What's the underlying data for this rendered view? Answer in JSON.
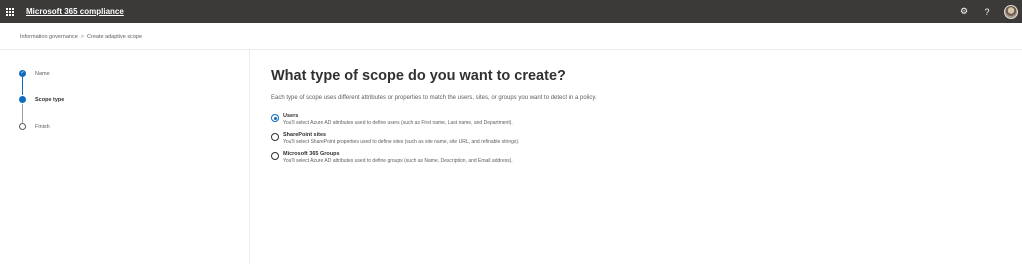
{
  "app": {
    "title": "Microsoft 365 compliance"
  },
  "topbar": {
    "icons": [
      "waffle-icon",
      "gear-icon",
      "help-icon",
      "avatar"
    ],
    "help_label": "?"
  },
  "breadcrumb": {
    "items": [
      "Information governance",
      "Create adaptive scope"
    ],
    "separator": ">"
  },
  "steps": [
    {
      "label": "Name",
      "state": "done"
    },
    {
      "label": "Scope type",
      "state": "current"
    },
    {
      "label": "Finish",
      "state": "todo"
    }
  ],
  "main": {
    "heading": "What type of scope do you want to create?",
    "description": "Each type of scope uses different attributes or properties to match the users, sites, or groups you want to detect in a policy.",
    "options": [
      {
        "title": "Users",
        "desc": "You'll select Azure AD attributes used to define users (such as First name, Last name, and Department).",
        "checked": true
      },
      {
        "title": "SharePoint sites",
        "desc": "You'll select SharePoint properties used to define sites (such as site name, site URL, and refinable strings).",
        "checked": false
      },
      {
        "title": "Microsoft 365 Groups",
        "desc": "You'll select Azure AD attributes used to define groups (such as Name, Description, and Email address).",
        "checked": false
      }
    ]
  },
  "colors": {
    "topbar": "#3b3a39",
    "accent": "#0f6cbd"
  }
}
